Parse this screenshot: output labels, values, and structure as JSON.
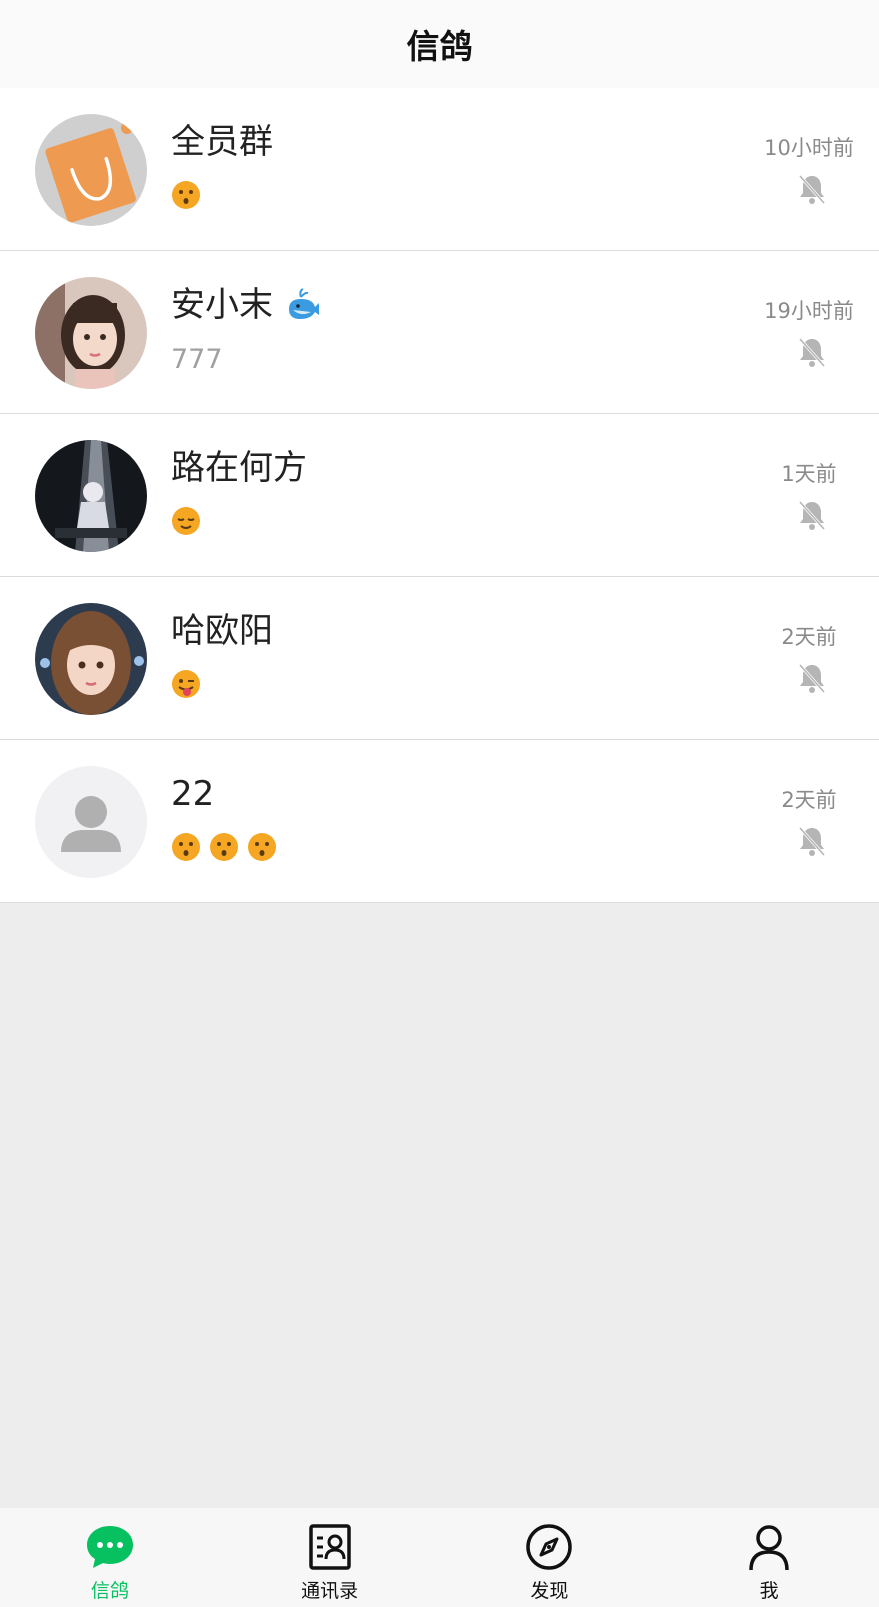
{
  "header": {
    "title": "信鸽"
  },
  "chats": [
    {
      "name": "全员群",
      "name_emoji": "",
      "preview_text": "",
      "preview_emojis": [
        "kissing-face"
      ],
      "time": "10小时前",
      "muted": true,
      "avatar": "orange-bag"
    },
    {
      "name": "安小末",
      "name_emoji": "whale",
      "preview_text": "777",
      "preview_emojis": [],
      "time": "19小时前",
      "muted": true,
      "avatar": "girl-1"
    },
    {
      "name": "路在何方",
      "name_emoji": "",
      "preview_text": "",
      "preview_emojis": [
        "relieved-face"
      ],
      "time": "1天前",
      "muted": true,
      "avatar": "dark-scene"
    },
    {
      "name": "哈欧阳",
      "name_emoji": "",
      "preview_text": "",
      "preview_emojis": [
        "winking-tongue-face"
      ],
      "time": "2天前",
      "muted": true,
      "avatar": "girl-2"
    },
    {
      "name": "22",
      "name_emoji": "",
      "preview_text": "",
      "preview_emojis": [
        "kissing-face",
        "kissing-face",
        "kissing-face"
      ],
      "time": "2天前",
      "muted": true,
      "avatar": "default-person"
    }
  ],
  "tabbar": {
    "tabs": [
      {
        "label": "信鸽",
        "icon": "chat-bubble-icon",
        "active": true
      },
      {
        "label": "通讯录",
        "icon": "contacts-icon",
        "active": false
      },
      {
        "label": "发现",
        "icon": "compass-icon",
        "active": false
      },
      {
        "label": "我",
        "icon": "person-icon",
        "active": false
      }
    ]
  },
  "colors": {
    "accent": "#07c160",
    "background": "#ededed",
    "header": "#fafafa"
  }
}
